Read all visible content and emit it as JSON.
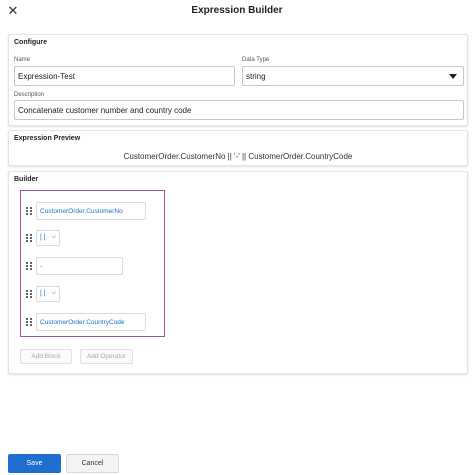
{
  "header": {
    "close_icon": "close-icon",
    "title": "Expression Builder"
  },
  "configure": {
    "section_title": "Configure",
    "name_label": "Name",
    "name_value": "Expression-Test",
    "data_type_label": "Data Type",
    "data_type_value": "string",
    "description_label": "Description",
    "description_value": "Concatenate customer number and country code"
  },
  "preview": {
    "section_title": "Expression Preview",
    "expression": "CustomerOrder.CustomerNo || '-' || CustomerOrder.CountryCode"
  },
  "builder": {
    "section_title": "Builder",
    "items": [
      {
        "kind": "block",
        "value": "CustomerOrder.CustomerNo"
      },
      {
        "kind": "operator",
        "value": "| |"
      },
      {
        "kind": "block",
        "value": "-"
      },
      {
        "kind": "operator",
        "value": "| |"
      },
      {
        "kind": "block",
        "value": "CustomerOrder.CountryCode"
      }
    ],
    "add_block_label": "Add Block",
    "add_operator_label": "Add Operator"
  },
  "footer": {
    "save_label": "Save",
    "cancel_label": "Cancel"
  },
  "colors": {
    "primary": "#1f6fd1",
    "builder_outline": "#a64ca6",
    "link_text": "#1a6fc4"
  }
}
